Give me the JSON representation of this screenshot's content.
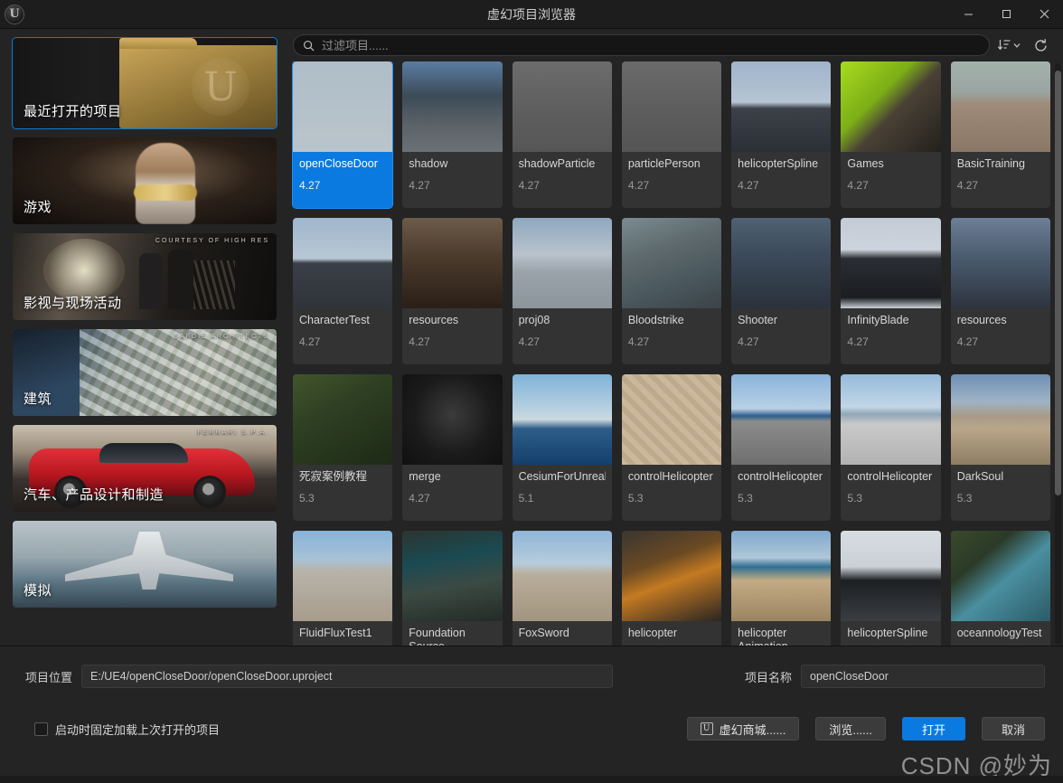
{
  "window": {
    "title": "虚幻项目浏览器",
    "logo_glyph": "U",
    "minimize": "—",
    "maximize": "☐",
    "close": "✕"
  },
  "toolbar": {
    "search_placeholder": "过滤项目......",
    "search_value": "",
    "search_icon": "⌕",
    "sort_icon": "↓≡",
    "sort_chevron": "⌄",
    "refresh_icon": "⟳"
  },
  "sidebar": {
    "categories": [
      {
        "label": "最近打开的项目",
        "credit": "",
        "art": "art-recent",
        "selected": true
      },
      {
        "label": "游戏",
        "credit": "",
        "art": "art-games",
        "selected": false
      },
      {
        "label": "影视与现场活动",
        "credit": "COURTESY OF HIGH RES",
        "art": "art-film",
        "selected": false
      },
      {
        "label": "建筑",
        "credit": "SAFDIE ARCHITECTS",
        "art": "art-arch",
        "selected": false
      },
      {
        "label": "汽车、产品设计和制造",
        "credit": "FERRARI S.P.A.",
        "art": "art-auto",
        "selected": false
      },
      {
        "label": "模拟",
        "credit": "",
        "art": "art-sim",
        "selected": false
      }
    ]
  },
  "projects": [
    {
      "name": "openCloseDoor",
      "version": "4.27",
      "selected": true,
      "thumb": "linear-gradient(180deg,#aebdc8 0%,#b6c2ca 60%,#b9c4cb 100%)"
    },
    {
      "name": "shadow",
      "version": "4.27",
      "selected": false,
      "thumb": "linear-gradient(180deg,#5a7da3 0%,#3c4b57 38%,#5b6268 70%,#6a7177 100%)"
    },
    {
      "name": "shadowParticle",
      "version": "4.27",
      "selected": false,
      "thumb": "linear-gradient(180deg,#6c6c6c 0%,#5d5d5d 60%,#565656 100%)"
    },
    {
      "name": "particlePerson",
      "version": "4.27",
      "selected": false,
      "thumb": "linear-gradient(180deg,#6a6a6a 0%,#5a5a5a 70%,#555 100%)"
    },
    {
      "name": "helicopterSpline",
      "version": "4.27",
      "selected": false,
      "thumb": "linear-gradient(180deg,#9fb4cc 0%,#b6c4d4 45%,#3c4048 52%,#2b2f36 100%)"
    },
    {
      "name": "Games",
      "version": "4.27",
      "selected": false,
      "thumb": "linear-gradient(135deg,#a8dc1d 0%,#7cae17 38%,#4a4136 55%,#23211c 100%)"
    },
    {
      "name": "BasicTraining",
      "version": "4.27",
      "selected": false,
      "thumb": "linear-gradient(180deg,#a3b2ac 0%,#9aa4a0 34%,#9e8a79 48%,#8b7766 100%)"
    },
    {
      "name": "CharacterTest",
      "version": "4.27",
      "selected": false,
      "thumb": "linear-gradient(180deg,#9fb6cd 0%,#b8c7d4 45%,#3b3f47 50%,#2f333a 100%)"
    },
    {
      "name": "resources",
      "version": "4.27",
      "selected": false,
      "thumb": "linear-gradient(180deg,#6c5b48 0%,#4a3a2c 45%,#2a1f17 100%)"
    },
    {
      "name": "proj08",
      "version": "4.27",
      "selected": false,
      "thumb": "linear-gradient(180deg,#8fa8bf 0%,#b9c3cc 40%,#9aa2aa 60%,#8d959c 100%)"
    },
    {
      "name": "Bloodstrike",
      "version": "4.27",
      "selected": false,
      "thumb": "linear-gradient(160deg,#7b8c92 0%,#5e6a6d 35%,#49565c 70%,#3a4348 100%)"
    },
    {
      "name": "Shooter",
      "version": "4.27",
      "selected": false,
      "thumb": "linear-gradient(180deg,#4f6173 0%,#3a4858 45%,#2a323c 100%)"
    },
    {
      "name": "InfinityBlade",
      "version": "4.27",
      "selected": false,
      "thumb": "linear-gradient(180deg,#c3cbd6 0%,#cdd4dd 35%,#2a2d33 45%,#1b1d21 88%,#c9cfd6 100%)"
    },
    {
      "name": "resources",
      "version": "4.27",
      "selected": false,
      "thumb": "linear-gradient(180deg,#6d7f96 0%,#4a5a6e 45%,#2c343e 100%)"
    },
    {
      "name": "死寂案例教程",
      "version": "5.3",
      "selected": false,
      "thumb": "linear-gradient(150deg,#42552c 0%,#2e3f22 40%,#1d2a17 100%)"
    },
    {
      "name": "merge",
      "version": "4.27",
      "selected": false,
      "thumb": "radial-gradient(circle at 50% 45%, #3b3b3b 0%, #1b1b1b 55%, #101010 100%)"
    },
    {
      "name": "CesiumForUnrealSamples",
      "version": "5.1",
      "selected": false,
      "thumb": "linear-gradient(180deg,#7fb3d8 0%,#bdd3e2 42%,#cdd9df 50%,#2e5d8a 60%,#13406b 100%)"
    },
    {
      "name": "controlHelicopter",
      "version": "5.3",
      "selected": false,
      "thumb": "repeating-linear-gradient(45deg,#cbb89c 0 6px,#bfa98b 6px 12px)"
    },
    {
      "name": "controlHelicopter",
      "version": "5.3",
      "selected": false,
      "thumb": "linear-gradient(180deg,#8ab4dc 0%,#b9d0e4 38%,#2c5d8c 46%,#8c8c8c 52%,#6f6f6f 100%)"
    },
    {
      "name": "controlHelicopter",
      "version": "5.3",
      "selected": false,
      "thumb": "linear-gradient(180deg,#95bada 0%,#c2d6e6 36%,#8fa8b8 44%,#c9c9c9 55%,#b2b2b2 100%)"
    },
    {
      "name": "DarkSoul",
      "version": "5.3",
      "selected": false,
      "thumb": "linear-gradient(180deg,#6e90b4 0%,#9fb3c5 30%,#a79a87 46%,#b9a68b 60%,#8e7c63 100%)"
    },
    {
      "name": "FluidFluxTest1",
      "version": "",
      "selected": false,
      "thumb": "linear-gradient(180deg,#87b2d9 0%,#a8c2d6 32%,#b7b3aa 44%,#a89c8b 100%)"
    },
    {
      "name": "Foundation Source",
      "version": "",
      "selected": false,
      "thumb": "linear-gradient(170deg,#2c3530 0%,#1a4a52 32%,#3c4a44 60%,#232b27 100%)"
    },
    {
      "name": "FoxSword",
      "version": "",
      "selected": false,
      "thumb": "linear-gradient(180deg,#8fb6d8 0%,#b7ccdc 36%,#b9ae9b 48%,#a2957f 100%)"
    },
    {
      "name": "helicopter",
      "version": "",
      "selected": false,
      "thumb": "linear-gradient(160deg,#3a3531 0%,#6b4a23 35%,#c47a22 55%,#2a2522 100%)"
    },
    {
      "name": "helicopter Animation",
      "version": "",
      "selected": false,
      "thumb": "linear-gradient(180deg,#7fa9cd 0%,#afc6d8 30%,#2f6f93 40%,#c3ab84 55%,#9b8461 100%)"
    },
    {
      "name": "helicopterSpline",
      "version": "",
      "selected": false,
      "thumb": "linear-gradient(180deg,#d8dde2 0%,#c9d0d6 40%,#1d1f22 55%,#3a3d42 100%)"
    },
    {
      "name": "oceannologyTest",
      "version": "",
      "selected": false,
      "thumb": "linear-gradient(140deg,#3a4a2c 0%,#2b3a27 30%,#4a8fa0 55%,#2c5a66 100%)"
    }
  ],
  "bottom": {
    "location_label": "项目位置",
    "location_value": "E:/UE4/openCloseDoor/openCloseDoor.uproject",
    "name_label": "项目名称",
    "name_value": "openCloseDoor",
    "checkbox_label": "启动时固定加载上次打开的项目",
    "checkbox_checked": false,
    "marketplace_button": "虚幻商城......",
    "browse_button": "浏览......",
    "open_button": "打开",
    "cancel_button": "取消",
    "marketplace_icon": "U"
  },
  "watermark": "CSDN @妙为"
}
